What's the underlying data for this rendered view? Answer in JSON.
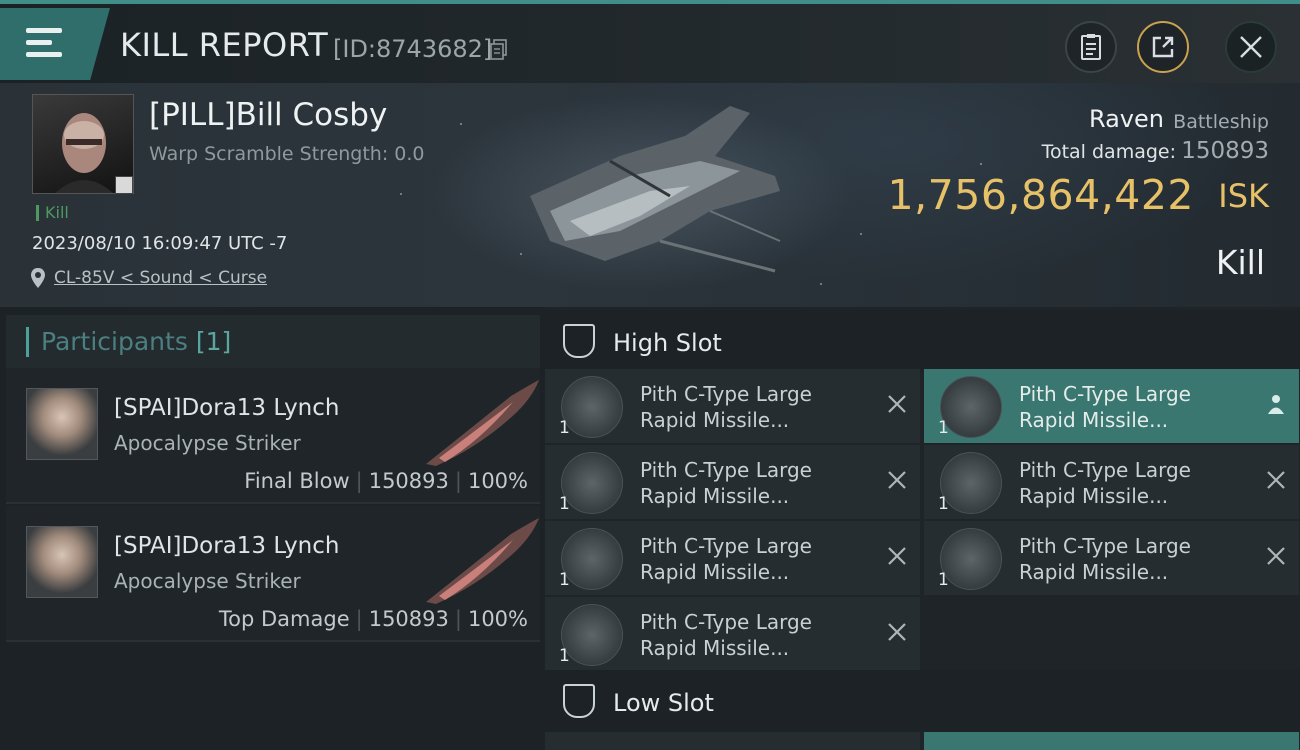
{
  "header": {
    "title": "KILL REPORT",
    "id_text": "[ID:8743682]",
    "icons": [
      "menu-icon",
      "copy-icon",
      "clipboard-icon",
      "share-icon",
      "close-icon"
    ]
  },
  "victim": {
    "name": "[PILL]Bill Cosby",
    "warp_text": "Warp Scramble Strength: 0.0",
    "kill_tag": "Kill",
    "timestamp": "2023/08/10 16:09:47 UTC -7",
    "location": "CL-85V < Sound < Curse"
  },
  "ship": {
    "name": "Raven",
    "class": "Battleship",
    "damage_label": "Total damage:",
    "damage_value": "150893",
    "isk_value": "1,756,864,422",
    "isk_unit": "ISK",
    "result": "Kill"
  },
  "participants": {
    "title": "Participants",
    "count": "[1]",
    "rows": [
      {
        "name": "[SPAI]Dora13 Lynch",
        "ship": "Apocalypse Striker",
        "role": "Final Blow",
        "damage": "150893",
        "percent": "100%"
      },
      {
        "name": "[SPAI]Dora13 Lynch",
        "ship": "Apocalypse Striker",
        "role": "Top Damage",
        "damage": "150893",
        "percent": "100%"
      }
    ]
  },
  "slots": {
    "high": {
      "title": "High Slot",
      "items": [
        {
          "qty": "1",
          "line1": "Pith C-Type Large",
          "line2": "Rapid Missile...",
          "status": "destroyed"
        },
        {
          "qty": "1",
          "line1": "Pith C-Type Large",
          "line2": "Rapid Missile...",
          "status": "dropped"
        },
        {
          "qty": "1",
          "line1": "Pith C-Type Large",
          "line2": "Rapid Missile...",
          "status": "destroyed"
        },
        {
          "qty": "1",
          "line1": "Pith C-Type Large",
          "line2": "Rapid Missile...",
          "status": "destroyed"
        },
        {
          "qty": "1",
          "line1": "Pith C-Type Large",
          "line2": "Rapid Missile...",
          "status": "destroyed"
        },
        {
          "qty": "1",
          "line1": "Pith C-Type Large",
          "line2": "Rapid Missile...",
          "status": "destroyed"
        },
        {
          "qty": "1",
          "line1": "Pith C-Type Large",
          "line2": "Rapid Missile...",
          "status": "destroyed"
        }
      ]
    },
    "low": {
      "title": "Low Slot"
    }
  },
  "colors": {
    "accent": "#3f8f88",
    "isk_gold": "#e7c168",
    "kill_green": "#4c9a62",
    "highlight": "#3a7771"
  }
}
